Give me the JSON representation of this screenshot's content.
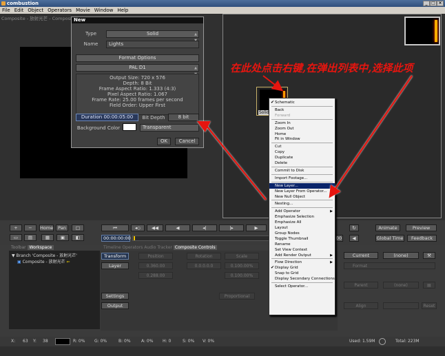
{
  "app": {
    "title": "combustion"
  },
  "menu": [
    "File",
    "Edit",
    "Object",
    "Operators",
    "Movie",
    "Window",
    "Help"
  ],
  "window_controls": {
    "minimize": "_",
    "maximize": "□",
    "close": "×"
  },
  "workspace": {
    "composite_caption": "Composite - 放射光芒 - Composite ..."
  },
  "dialog": {
    "title": "New",
    "type_label": "Type",
    "type_value": "Solid",
    "name_label": "Name",
    "name_value": "Lights",
    "format_options": "Format Options",
    "format_value": "PAL D1",
    "info": [
      "Output Size: 720 x 576",
      "Depth: 8 Bit",
      "Frame Aspect Ratio: 1.333 (4:3)",
      "Pixel Aspect Ratio: 1.067",
      "Frame Rate: 25.00 frames per second",
      "Field Order: Upper First"
    ],
    "duration": "Duration 00:00:05:00",
    "bit_depth_label": "Bit Depth",
    "bit_depth_value": "8 bit",
    "bg_color_label": "Background Color",
    "bg_color_value": "Transparent",
    "bg_swatch": "#ffffff",
    "ok": "OK",
    "cancel": "Cancel"
  },
  "annotation": {
    "text": "在此处点击右键,在弹出列表中,选择此项",
    "color": "#e6150f"
  },
  "node": {
    "label": "Solid"
  },
  "context_menu": [
    {
      "label": "Schematic",
      "checked": true
    },
    {
      "sep": true
    },
    {
      "label": "Back"
    },
    {
      "label": "Forward",
      "disabled": true
    },
    {
      "sep": true
    },
    {
      "label": "Zoom In"
    },
    {
      "label": "Zoom Out"
    },
    {
      "label": "Home"
    },
    {
      "label": "Fit in Window"
    },
    {
      "sep": true
    },
    {
      "label": "Cut"
    },
    {
      "label": "Copy"
    },
    {
      "label": "Duplicate"
    },
    {
      "label": "Delete"
    },
    {
      "sep": true
    },
    {
      "label": "Commit to Disk"
    },
    {
      "sep": true
    },
    {
      "label": "Import Footage..."
    },
    {
      "sep": true
    },
    {
      "label": "New Layer...",
      "selected": true
    },
    {
      "label": "New Layer From Operator...",
      "submenu": true
    },
    {
      "label": "New Null Object"
    },
    {
      "sep": true
    },
    {
      "label": "Nesting..."
    },
    {
      "sep": true
    },
    {
      "label": "Add Operator",
      "submenu": true
    },
    {
      "label": "Emphasize Selection"
    },
    {
      "label": "Emphasize All"
    },
    {
      "label": "Layout"
    },
    {
      "label": "Group Nodes"
    },
    {
      "label": "Toggle Thumbnail"
    },
    {
      "label": "Rename"
    },
    {
      "label": "Set View Context"
    },
    {
      "label": "Add Render Output",
      "submenu": true
    },
    {
      "sep": true
    },
    {
      "label": "Flow Direction",
      "submenu": true
    },
    {
      "label": "Display Grid",
      "checked": true
    },
    {
      "label": "Snap to Grid"
    },
    {
      "label": "Display Secondary Connections"
    },
    {
      "sep": true
    },
    {
      "label": "Select Operator..."
    }
  ],
  "toolbar": {
    "plus": "+",
    "minus": "−",
    "home": "Home",
    "pan": "Pan",
    "timecode": "00:00:00:00",
    "tc_end": "00",
    "animate": "Animate",
    "preview": "Preview",
    "global_time": "Global Time",
    "feedback": "Feedback"
  },
  "panel_tabs": {
    "left": [
      "Toolbar",
      "Workspace"
    ],
    "right": [
      "Timeline",
      "Operators",
      "Audio",
      "Tracker",
      "Composite Controls"
    ]
  },
  "tree": {
    "branch": "Branch 'Composite - 放射光芒'",
    "child": "Composite - 放射光芒"
  },
  "controls": {
    "transform": "Transform",
    "layer": "Layer",
    "settings": "Settings",
    "output": "Output",
    "position": "Position",
    "rotation": "Rotation",
    "scale": "Scale",
    "pos_x": "0.360.00",
    "pos_y": "0.288.00",
    "rot": "0.0.0.0.0",
    "sc_x": "0.100.00%",
    "sc_y": "0.100.00%",
    "proportional": "Proportional",
    "current": "Current",
    "none": "(none)",
    "parent": "Parent",
    "align": "Align",
    "reset": "Reset",
    "format": "Format"
  },
  "status": {
    "x_label": "X:",
    "x": "63",
    "y_label": "Y:",
    "y": "38",
    "r": "R: 0%",
    "g": "G: 0%",
    "b": "B: 0%",
    "a": "A: 0%",
    "h": "H: 0",
    "s": "S: 0%",
    "v": "V: 0%",
    "used": "Used: 1.59M",
    "total": "Total: 223M"
  }
}
